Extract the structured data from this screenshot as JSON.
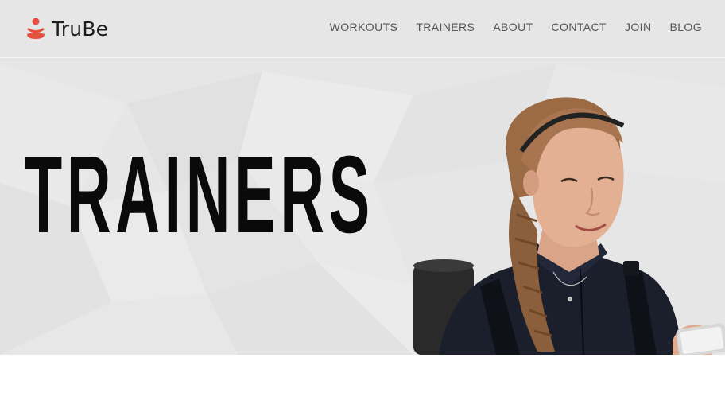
{
  "brand": {
    "name": "TruBe",
    "accent": "#e4513f"
  },
  "nav": {
    "items": [
      {
        "label": "WORKOUTS"
      },
      {
        "label": "TRAINERS"
      },
      {
        "label": "ABOUT"
      },
      {
        "label": "CONTACT"
      },
      {
        "label": "JOIN"
      },
      {
        "label": "BLOG"
      }
    ]
  },
  "hero": {
    "title": "TRAINERS",
    "image": "trainer-photo"
  }
}
